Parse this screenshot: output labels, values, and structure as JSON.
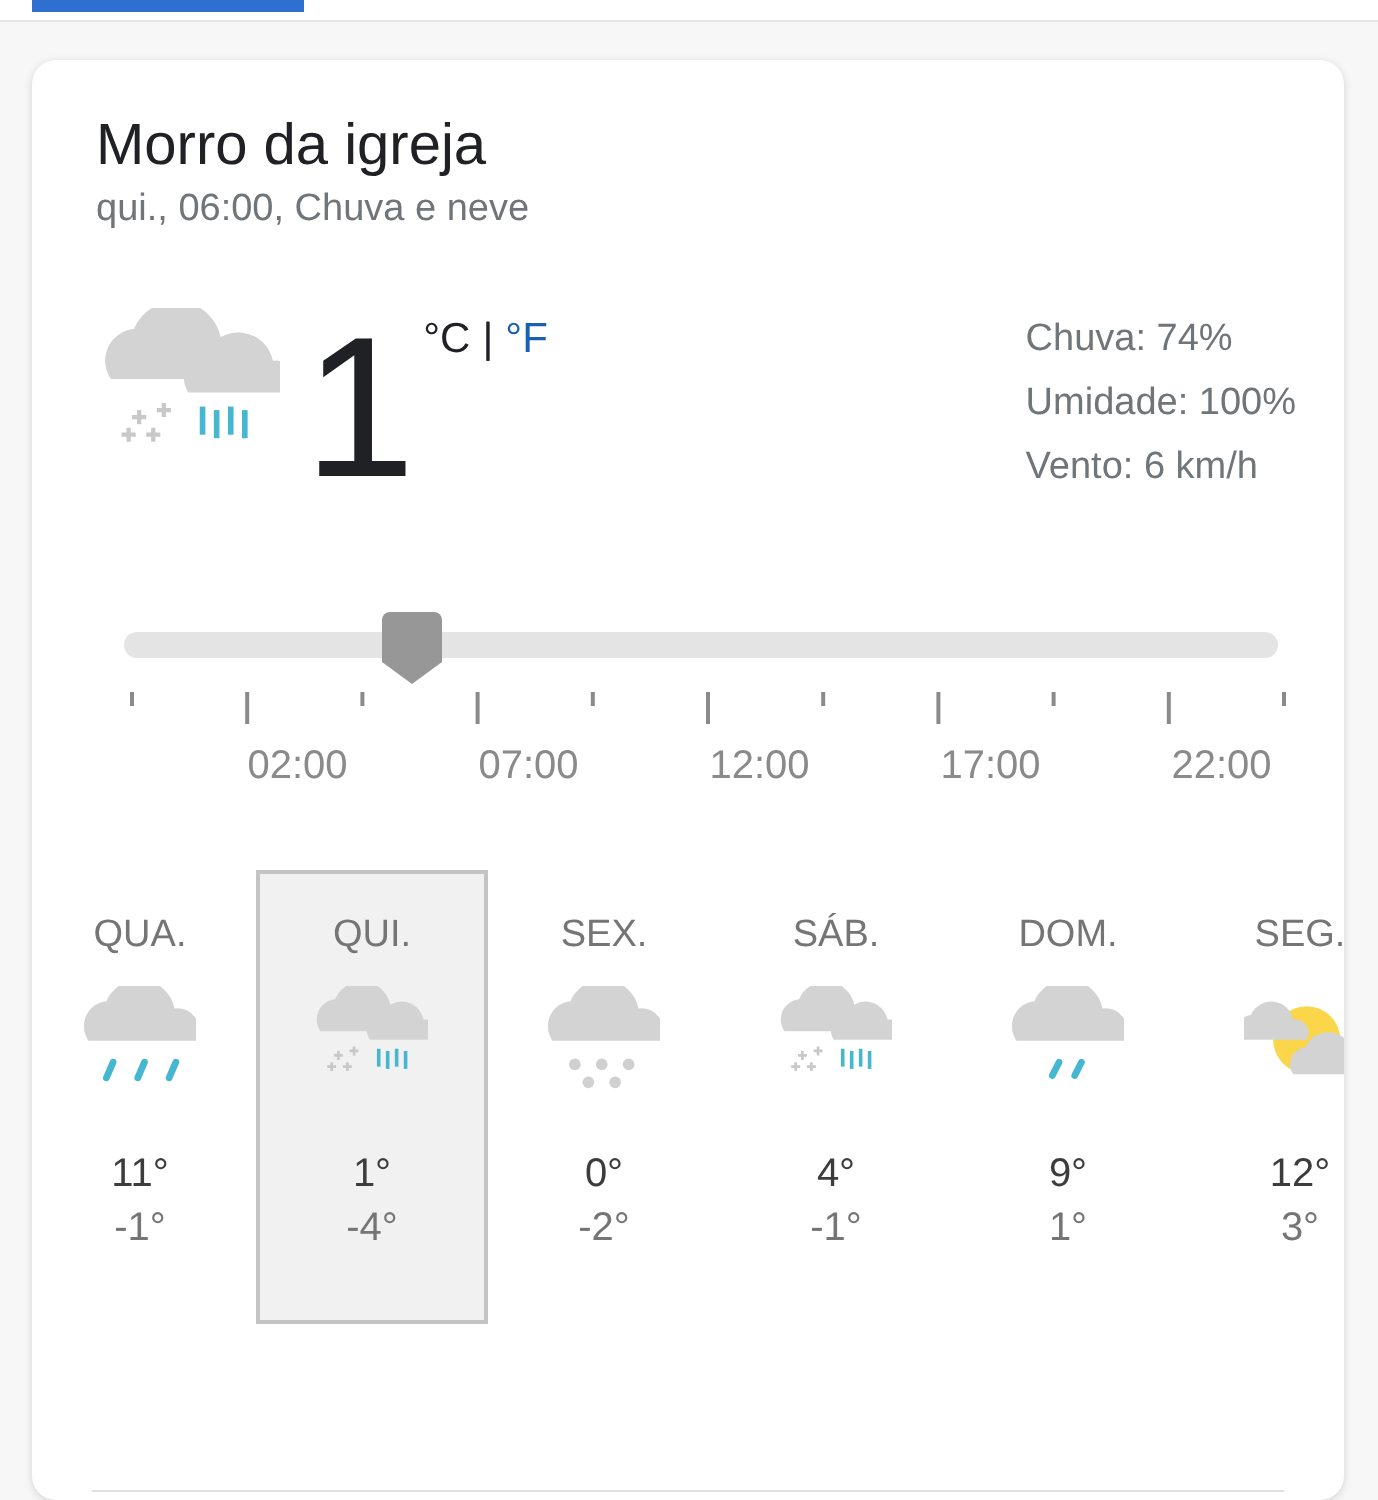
{
  "location": {
    "title": "Morro da igreja",
    "subtitle": "qui., 06:00, Chuva e neve"
  },
  "current": {
    "icon": {
      "kind": "rain-snow"
    },
    "temperature": "1",
    "units": [
      {
        "label": "°C",
        "selected": true
      },
      {
        "label": "°F",
        "selected": false
      }
    ],
    "separator": "|",
    "details": [
      "Chuva: 74%",
      "Umidade: 100%",
      "Vento: 6 km/h"
    ]
  },
  "timeline": {
    "level": 0.25,
    "labels": [
      "02:00",
      "07:00",
      "12:00",
      "17:00",
      "22:00"
    ]
  },
  "days": [
    {
      "day": "QUA.",
      "kind": "rain",
      "high": "11°",
      "low": "-1°",
      "selected": false
    },
    {
      "day": "QUI.",
      "kind": "rain-snow",
      "high": "1°",
      "low": "-4°",
      "selected": true
    },
    {
      "day": "SEX.",
      "kind": "snow",
      "high": "0°",
      "low": "-2°",
      "selected": false
    },
    {
      "day": "SÁB.",
      "kind": "rain-snow",
      "high": "4°",
      "low": "-1°",
      "selected": false
    },
    {
      "day": "DOM.",
      "kind": "light-rain",
      "high": "9°",
      "low": "1°",
      "selected": false
    },
    {
      "day": "SEG.",
      "kind": "partly-cloudy",
      "high": "12°",
      "low": "3°",
      "selected": false
    }
  ]
}
